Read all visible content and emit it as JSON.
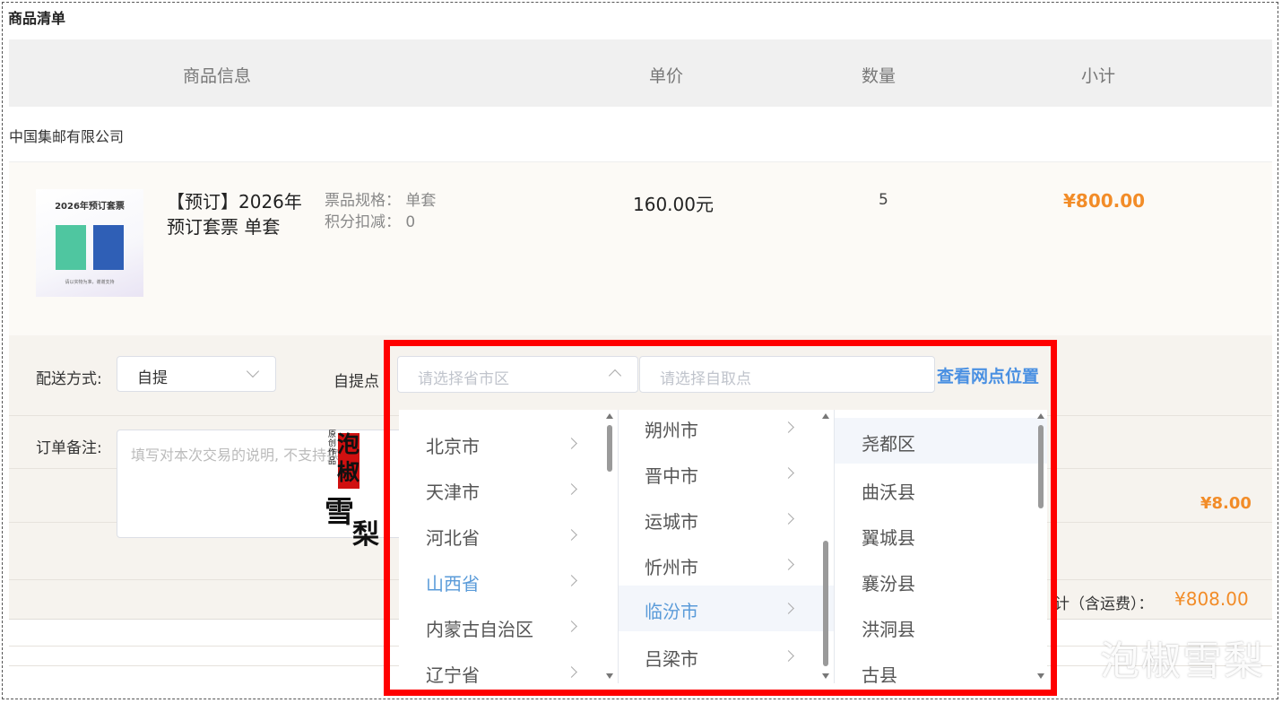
{
  "section_title": "商品清单",
  "table_header": {
    "info": "商品信息",
    "price": "单价",
    "qty": "数量",
    "subtotal": "小计"
  },
  "shop": {
    "name": "中国集邮有限公司"
  },
  "item": {
    "image_title": "2026年预订套票",
    "image_caption": "请以实物为准，谢谢支持",
    "name": "【预订】2026年预订套票 单套",
    "spec": "票品规格： 单套",
    "points": "积分扣减： 0",
    "price": "160.00元",
    "qty": "5",
    "subtotal": "¥800.00"
  },
  "delivery": {
    "label": "配送方式:",
    "selected": "自提",
    "pickup_label": "自提点",
    "region_placeholder": "请选择省市区",
    "pickup_placeholder": "请选择自取点",
    "map_link": "查看网点位置"
  },
  "note": {
    "label": "订单备注:",
    "placeholder": "填写对本次交易的说明, 不支持换货"
  },
  "freight": "¥8.00",
  "total": {
    "label": "计（含运费）：",
    "value": "¥808.00"
  },
  "cascader": {
    "provinces": [
      "北京市",
      "天津市",
      "河北省",
      "山西省",
      "内蒙古自治区",
      "辽宁省"
    ],
    "selected_province": "山西省",
    "cities": [
      "朔州市",
      "晋中市",
      "运城市",
      "忻州市",
      "临汾市",
      "吕梁市"
    ],
    "selected_city": "临汾市",
    "districts": [
      "尧都区",
      "曲沃县",
      "翼城县",
      "襄汾县",
      "洪洞县",
      "古县"
    ],
    "hovered_district": "尧都区"
  },
  "watermark": {
    "stamp_small": "原创作品",
    "stamp_chars": "泡椒",
    "stamp_xue": "雪",
    "stamp_li": "梨",
    "corner_text": "泡椒雪梨"
  },
  "colors": {
    "accent_orange": "#f28c28",
    "link_blue": "#4a90e2",
    "highlight_red": "#ff0000"
  }
}
